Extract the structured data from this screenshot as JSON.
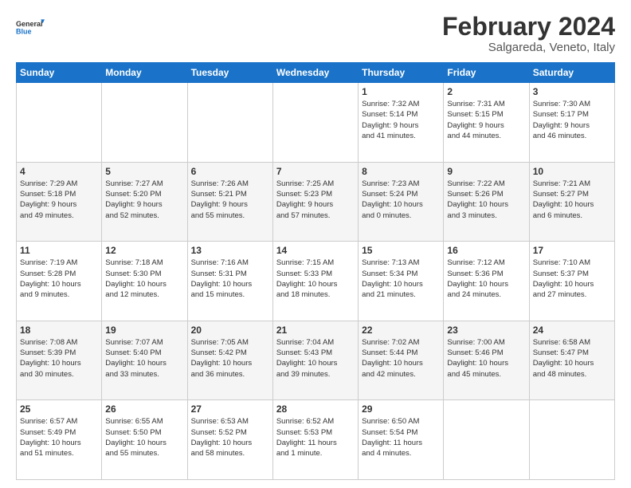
{
  "logo": {
    "line1": "General",
    "line2": "Blue"
  },
  "title": "February 2024",
  "subtitle": "Salgareda, Veneto, Italy",
  "weekdays": [
    "Sunday",
    "Monday",
    "Tuesday",
    "Wednesday",
    "Thursday",
    "Friday",
    "Saturday"
  ],
  "weeks": [
    [
      {
        "day": "",
        "info": ""
      },
      {
        "day": "",
        "info": ""
      },
      {
        "day": "",
        "info": ""
      },
      {
        "day": "",
        "info": ""
      },
      {
        "day": "1",
        "info": "Sunrise: 7:32 AM\nSunset: 5:14 PM\nDaylight: 9 hours\nand 41 minutes."
      },
      {
        "day": "2",
        "info": "Sunrise: 7:31 AM\nSunset: 5:15 PM\nDaylight: 9 hours\nand 44 minutes."
      },
      {
        "day": "3",
        "info": "Sunrise: 7:30 AM\nSunset: 5:17 PM\nDaylight: 9 hours\nand 46 minutes."
      }
    ],
    [
      {
        "day": "4",
        "info": "Sunrise: 7:29 AM\nSunset: 5:18 PM\nDaylight: 9 hours\nand 49 minutes."
      },
      {
        "day": "5",
        "info": "Sunrise: 7:27 AM\nSunset: 5:20 PM\nDaylight: 9 hours\nand 52 minutes."
      },
      {
        "day": "6",
        "info": "Sunrise: 7:26 AM\nSunset: 5:21 PM\nDaylight: 9 hours\nand 55 minutes."
      },
      {
        "day": "7",
        "info": "Sunrise: 7:25 AM\nSunset: 5:23 PM\nDaylight: 9 hours\nand 57 minutes."
      },
      {
        "day": "8",
        "info": "Sunrise: 7:23 AM\nSunset: 5:24 PM\nDaylight: 10 hours\nand 0 minutes."
      },
      {
        "day": "9",
        "info": "Sunrise: 7:22 AM\nSunset: 5:26 PM\nDaylight: 10 hours\nand 3 minutes."
      },
      {
        "day": "10",
        "info": "Sunrise: 7:21 AM\nSunset: 5:27 PM\nDaylight: 10 hours\nand 6 minutes."
      }
    ],
    [
      {
        "day": "11",
        "info": "Sunrise: 7:19 AM\nSunset: 5:28 PM\nDaylight: 10 hours\nand 9 minutes."
      },
      {
        "day": "12",
        "info": "Sunrise: 7:18 AM\nSunset: 5:30 PM\nDaylight: 10 hours\nand 12 minutes."
      },
      {
        "day": "13",
        "info": "Sunrise: 7:16 AM\nSunset: 5:31 PM\nDaylight: 10 hours\nand 15 minutes."
      },
      {
        "day": "14",
        "info": "Sunrise: 7:15 AM\nSunset: 5:33 PM\nDaylight: 10 hours\nand 18 minutes."
      },
      {
        "day": "15",
        "info": "Sunrise: 7:13 AM\nSunset: 5:34 PM\nDaylight: 10 hours\nand 21 minutes."
      },
      {
        "day": "16",
        "info": "Sunrise: 7:12 AM\nSunset: 5:36 PM\nDaylight: 10 hours\nand 24 minutes."
      },
      {
        "day": "17",
        "info": "Sunrise: 7:10 AM\nSunset: 5:37 PM\nDaylight: 10 hours\nand 27 minutes."
      }
    ],
    [
      {
        "day": "18",
        "info": "Sunrise: 7:08 AM\nSunset: 5:39 PM\nDaylight: 10 hours\nand 30 minutes."
      },
      {
        "day": "19",
        "info": "Sunrise: 7:07 AM\nSunset: 5:40 PM\nDaylight: 10 hours\nand 33 minutes."
      },
      {
        "day": "20",
        "info": "Sunrise: 7:05 AM\nSunset: 5:42 PM\nDaylight: 10 hours\nand 36 minutes."
      },
      {
        "day": "21",
        "info": "Sunrise: 7:04 AM\nSunset: 5:43 PM\nDaylight: 10 hours\nand 39 minutes."
      },
      {
        "day": "22",
        "info": "Sunrise: 7:02 AM\nSunset: 5:44 PM\nDaylight: 10 hours\nand 42 minutes."
      },
      {
        "day": "23",
        "info": "Sunrise: 7:00 AM\nSunset: 5:46 PM\nDaylight: 10 hours\nand 45 minutes."
      },
      {
        "day": "24",
        "info": "Sunrise: 6:58 AM\nSunset: 5:47 PM\nDaylight: 10 hours\nand 48 minutes."
      }
    ],
    [
      {
        "day": "25",
        "info": "Sunrise: 6:57 AM\nSunset: 5:49 PM\nDaylight: 10 hours\nand 51 minutes."
      },
      {
        "day": "26",
        "info": "Sunrise: 6:55 AM\nSunset: 5:50 PM\nDaylight: 10 hours\nand 55 minutes."
      },
      {
        "day": "27",
        "info": "Sunrise: 6:53 AM\nSunset: 5:52 PM\nDaylight: 10 hours\nand 58 minutes."
      },
      {
        "day": "28",
        "info": "Sunrise: 6:52 AM\nSunset: 5:53 PM\nDaylight: 11 hours\nand 1 minute."
      },
      {
        "day": "29",
        "info": "Sunrise: 6:50 AM\nSunset: 5:54 PM\nDaylight: 11 hours\nand 4 minutes."
      },
      {
        "day": "",
        "info": ""
      },
      {
        "day": "",
        "info": ""
      }
    ]
  ]
}
